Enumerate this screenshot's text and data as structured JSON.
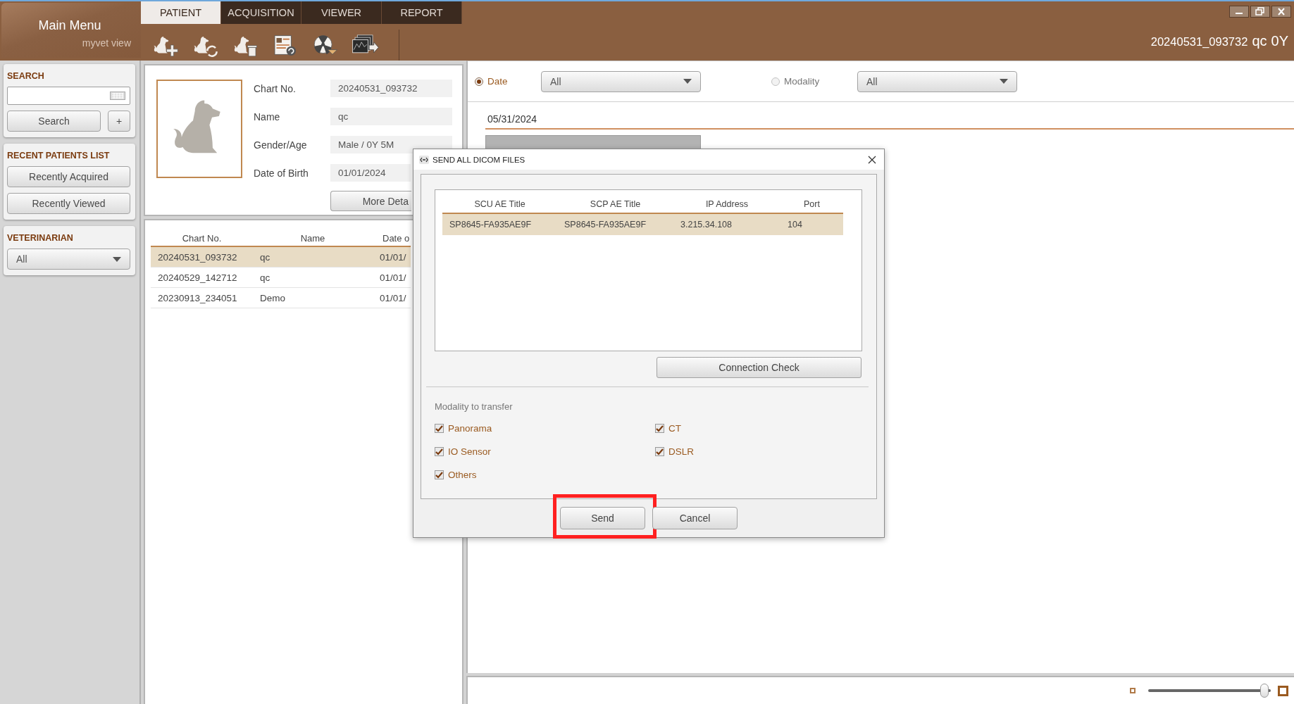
{
  "header": {
    "app_title": "Main Menu",
    "app_subtitle": "myvet view",
    "tabs": [
      {
        "label": "PATIENT",
        "selected": true
      },
      {
        "label": "ACQUISITION",
        "selected": false
      },
      {
        "label": "VIEWER",
        "selected": false
      },
      {
        "label": "REPORT",
        "selected": false
      }
    ],
    "patient_label": {
      "chart_no": "20240531_093732",
      "name": "qc",
      "age": "0Y"
    }
  },
  "search": {
    "title": "SEARCH",
    "button": "Search",
    "add_button": "+"
  },
  "recent": {
    "title": "RECENT PATIENTS LIST",
    "buttons": [
      "Recently Acquired",
      "Recently Viewed"
    ]
  },
  "veterinarian": {
    "title": "VETERINARIAN",
    "value": "All"
  },
  "patient_info": {
    "fields": [
      {
        "label": "Chart No.",
        "value": "20240531_093732"
      },
      {
        "label": "Name",
        "value": "qc"
      },
      {
        "label": "Gender/Age",
        "value": "Male / 0Y 5M"
      },
      {
        "label": "Date of Birth",
        "value": "01/01/2024"
      }
    ],
    "more_button": "More Deta"
  },
  "patient_list": {
    "columns": [
      "Chart No.",
      "Name",
      "Date o"
    ],
    "rows": [
      {
        "cells": [
          "20240531_093732",
          "qc",
          "01/01/"
        ],
        "selected": true
      },
      {
        "cells": [
          "20240529_142712",
          "qc",
          "01/01/"
        ],
        "selected": false
      },
      {
        "cells": [
          "20230913_234051",
          "Demo",
          "01/01/"
        ],
        "selected": false
      }
    ]
  },
  "filters": [
    {
      "label": "Date",
      "selected": true,
      "value": "All"
    },
    {
      "label": "Modality",
      "selected": false,
      "value": "All"
    }
  ],
  "study_group": {
    "date": "05/31/2024"
  },
  "zoom_slider": {
    "level": 0.98
  },
  "dialog": {
    "title": "SEND ALL DICOM FILES",
    "table": {
      "columns": [
        "SCU AE Title",
        "SCP AE Title",
        "IP Address",
        "Port"
      ],
      "rows": [
        {
          "cells": [
            "SP8645-FA935AE9F",
            "SP8645-FA935AE9F",
            "3.215.34.108",
            "104"
          ],
          "selected": true
        }
      ]
    },
    "connection_button": "Connection Check",
    "modality_label": "Modality to transfer",
    "modalities": [
      {
        "label": "Panorama",
        "checked": true
      },
      {
        "label": "CT",
        "checked": true
      },
      {
        "label": "IO Sensor",
        "checked": true
      },
      {
        "label": "DSLR",
        "checked": true
      },
      {
        "label": "Others",
        "checked": true
      }
    ],
    "buttons": [
      {
        "label": "Send",
        "highlighted": true
      },
      {
        "label": "Cancel",
        "highlighted": false
      }
    ]
  }
}
